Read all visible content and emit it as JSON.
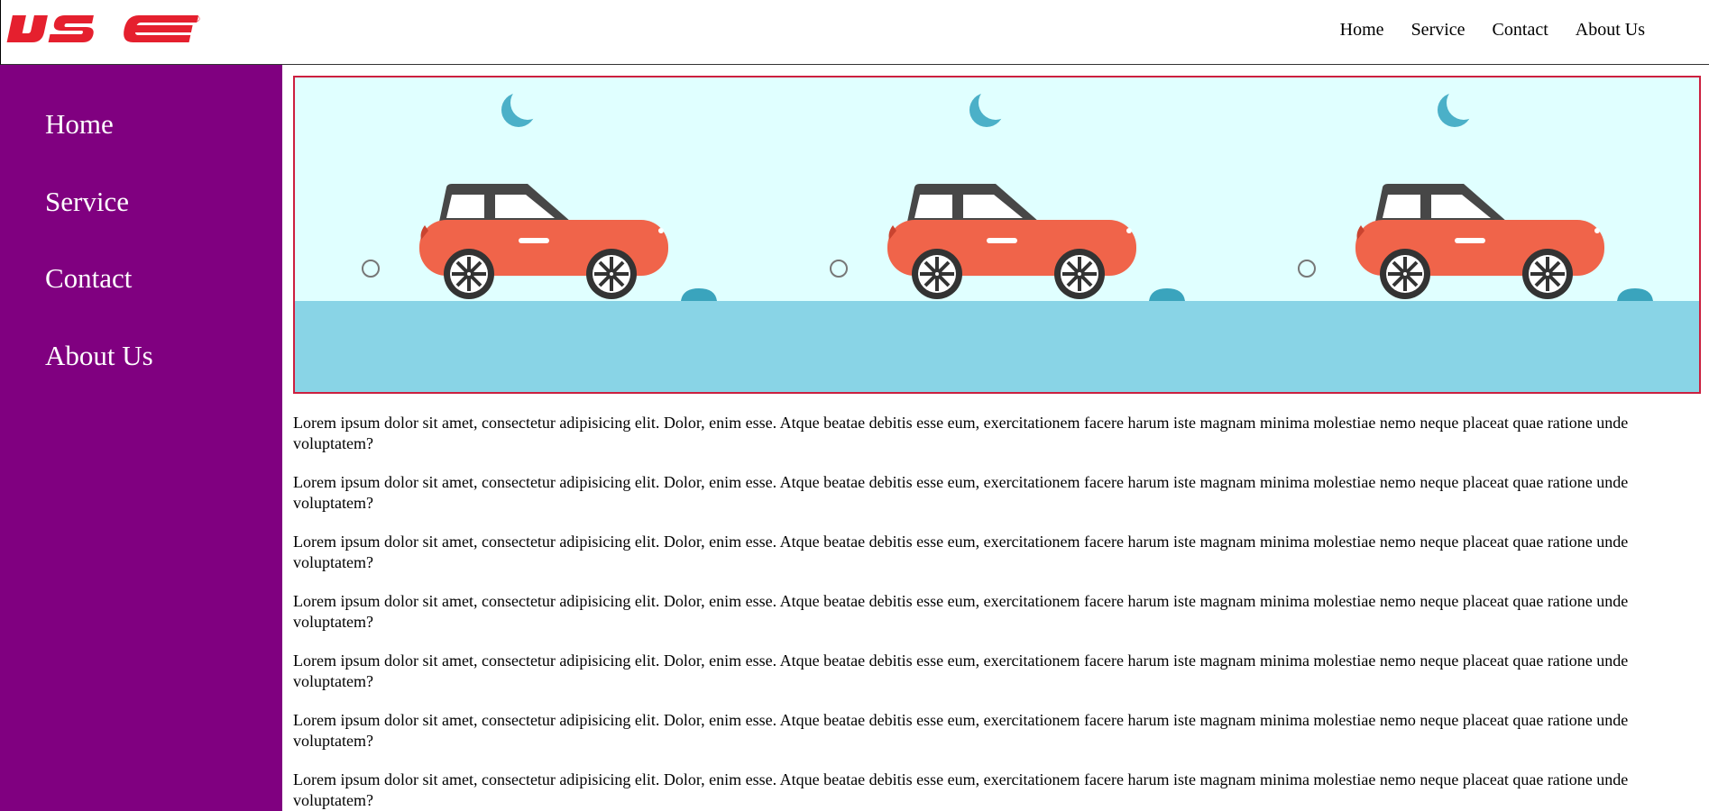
{
  "header": {
    "logo_text": "IJSE",
    "logo_mark": "®",
    "nav": [
      "Home",
      "Service",
      "Contact",
      "About Us"
    ]
  },
  "sidebar": {
    "items": [
      "Home",
      "Service",
      "Contact",
      "About Us"
    ]
  },
  "banner": {
    "scene": "cartoon-car-animation",
    "colors": {
      "sky": "#e0ffff",
      "ground": "#89d4e6",
      "car_body": "#f0644a",
      "roof": "#474747",
      "moon": "#4bb0c8",
      "border": "#cc1f3f"
    }
  },
  "paragraphs": [
    "Lorem ipsum dolor sit amet, consectetur adipisicing elit. Dolor, enim esse. Atque beatae debitis esse eum, exercitationem facere harum iste magnam minima molestiae nemo neque placeat quae ratione unde voluptatem?",
    "Lorem ipsum dolor sit amet, consectetur adipisicing elit. Dolor, enim esse. Atque beatae debitis esse eum, exercitationem facere harum iste magnam minima molestiae nemo neque placeat quae ratione unde voluptatem?",
    "Lorem ipsum dolor sit amet, consectetur adipisicing elit. Dolor, enim esse. Atque beatae debitis esse eum, exercitationem facere harum iste magnam minima molestiae nemo neque placeat quae ratione unde voluptatem?",
    "Lorem ipsum dolor sit amet, consectetur adipisicing elit. Dolor, enim esse. Atque beatae debitis esse eum, exercitationem facere harum iste magnam minima molestiae nemo neque placeat quae ratione unde voluptatem?",
    "Lorem ipsum dolor sit amet, consectetur adipisicing elit. Dolor, enim esse. Atque beatae debitis esse eum, exercitationem facere harum iste magnam minima molestiae nemo neque placeat quae ratione unde voluptatem?",
    "Lorem ipsum dolor sit amet, consectetur adipisicing elit. Dolor, enim esse. Atque beatae debitis esse eum, exercitationem facere harum iste magnam minima molestiae nemo neque placeat quae ratione unde voluptatem?",
    "Lorem ipsum dolor sit amet, consectetur adipisicing elit. Dolor, enim esse. Atque beatae debitis esse eum, exercitationem facere harum iste magnam minima molestiae nemo neque placeat quae ratione unde voluptatem?"
  ]
}
